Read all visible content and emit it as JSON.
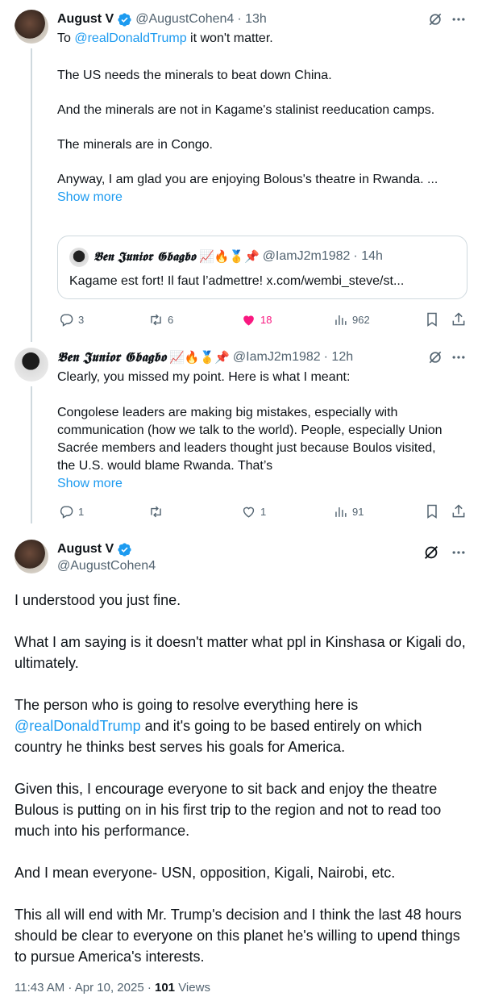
{
  "tweet1": {
    "name": "August V",
    "handle": "@AugustCohen4",
    "time": "· 13h",
    "reply_prefix": "To ",
    "reply_mention": "@realDonaldTrump",
    "reply_suffix": " it won't matter.",
    "paragraphs": [
      "The US needs the minerals to beat down China.",
      "And the minerals are not in Kagame's stalinist reeducation camps.",
      "The minerals are in Congo.",
      "Anyway, I am glad you are enjoying Bolous's theatre in Rwanda. ..."
    ],
    "show_more": "Show more",
    "quote": {
      "name": "𝕭𝖊𝖓 𝕵𝖚𝖓𝖎𝖔𝖗 𝕲𝖇𝖆𝖌𝖇𝖔",
      "emojis": "📈🔥🥇📌",
      "handle": "@IamJ2m1982",
      "time": "· 14h",
      "text": "Kagame est fort! Il faut l’admettre! x.com/wembi_steve/st..."
    },
    "stats": {
      "replies": "3",
      "reposts": "6",
      "likes": "18",
      "views": "962"
    }
  },
  "tweet2": {
    "name": "𝕭𝖊𝖓 𝕵𝖚𝖓𝖎𝖔𝖗 𝕲𝖇𝖆𝖌𝖇𝖔",
    "emojis": "📈🔥🥇📌",
    "handle": "@IamJ2m1982",
    "time": "· 12h",
    "paragraphs": [
      "Clearly, you missed my point. Here is what I meant:",
      "Congolese leaders are making big mistakes, especially with communication (how we talk to the world). People, especially Union Sacrée members and leaders thought just because Boulos visited, the U.S. would blame Rwanda. That’s"
    ],
    "show_more": "Show more",
    "stats": {
      "replies": "1",
      "reposts": "",
      "likes": "1",
      "views": "91"
    }
  },
  "main": {
    "name": "August V",
    "handle": "@AugustCohen4",
    "paragraphs": [
      "I understood you just fine.",
      "What I am saying is it doesn't matter what ppl in Kinshasa or Kigali do, ultimately."
    ],
    "p3_prefix": "The person who is going to resolve everything here is ",
    "p3_mention": "@realDonaldTrump",
    "p3_suffix": " and it's going to be based entirely on which country he thinks best serves his goals for America.",
    "paragraphs2": [
      "Given this, I encourage everyone to sit back and enjoy the theatre Bulous is putting on in his first trip to the region and not to read too much into his performance.",
      "And I mean everyone- USN, opposition, Kigali, Nairobi, etc.",
      "This all will end with Mr. Trump's decision and I think the last 48 hours should be clear to everyone on this planet he's willing to upend things to pursue America's interests."
    ],
    "timestamp": "11:43 AM · Apr 10, 2025 · ",
    "views_count": "101",
    "views_label": " Views"
  },
  "colors": {
    "accent": "#1d9bf0",
    "like": "#f91880",
    "muted": "#536471",
    "line": "#cfd9de"
  }
}
